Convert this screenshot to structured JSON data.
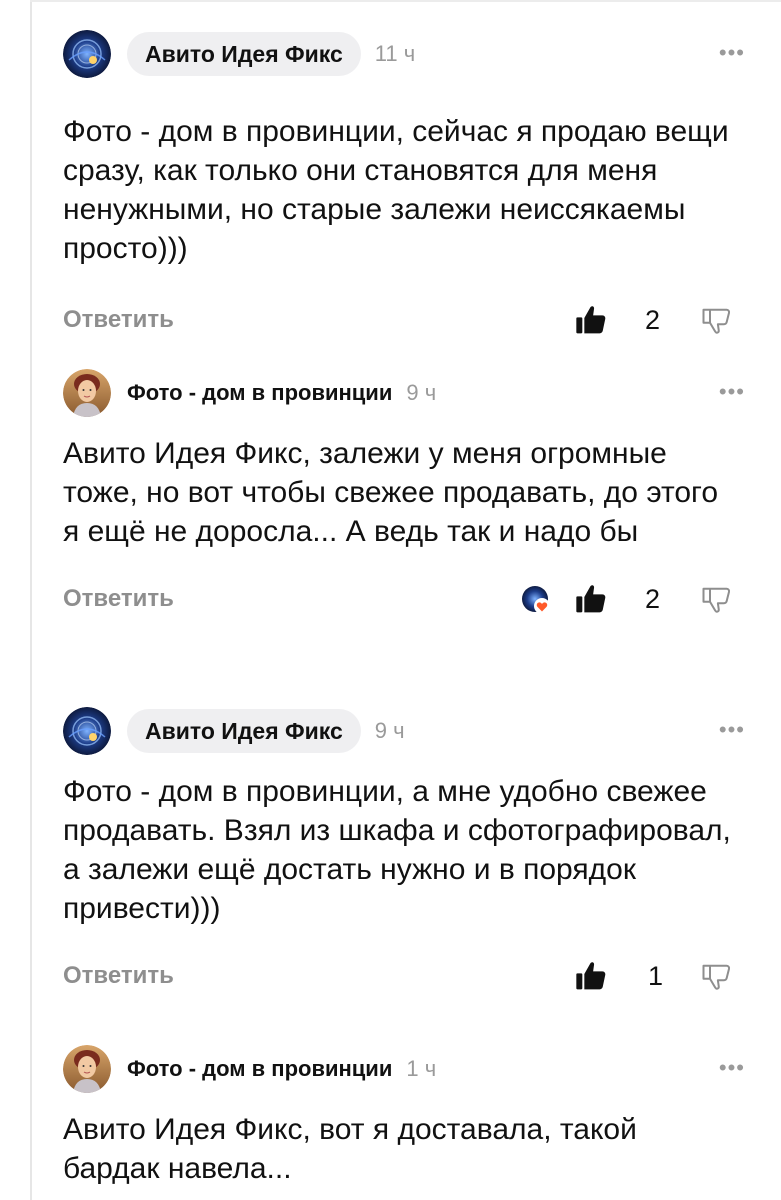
{
  "comments": [
    {
      "author": "Авито Идея Фикс",
      "time": "11 ч",
      "text": "Фото - дом в провинции, сейчас я продаю вещи сразу, как только они становятся для меня ненужными, но старые залежи неиссякаемы просто)))",
      "reply_label": "Ответить",
      "likes": "2",
      "more": "•••"
    },
    {
      "author": "Фото - дом в провинции",
      "time": "9 ч",
      "text": "Авито Идея Фикс, залежи у меня огромные тоже, но вот чтобы свежее продавать, до этого я ещё не доросла... А ведь так и надо бы",
      "reply_label": "Ответить",
      "likes": "2",
      "more": "•••"
    },
    {
      "author": "Авито Идея Фикс",
      "time": "9 ч",
      "text": "Фото - дом в провинции, а мне удобно свежее продавать. Взял из шкафа и сфотографировал, а залежи ещё достать нужно и в порядок привести)))",
      "reply_label": "Ответить",
      "likes": "1",
      "more": "•••"
    },
    {
      "author": "Фото - дом в провинции",
      "time": "1 ч",
      "text": "Авито Идея Фикс, вот я доставала, такой бардак навела...",
      "more": "•••"
    }
  ],
  "icons": {
    "like": "thumbs-up-icon",
    "dislike": "thumbs-down-icon",
    "more": "more-dots-icon"
  },
  "colors": {
    "pill_bg": "#efeff1",
    "muted": "#8e8e8e",
    "heart": "#ff5a2a"
  }
}
